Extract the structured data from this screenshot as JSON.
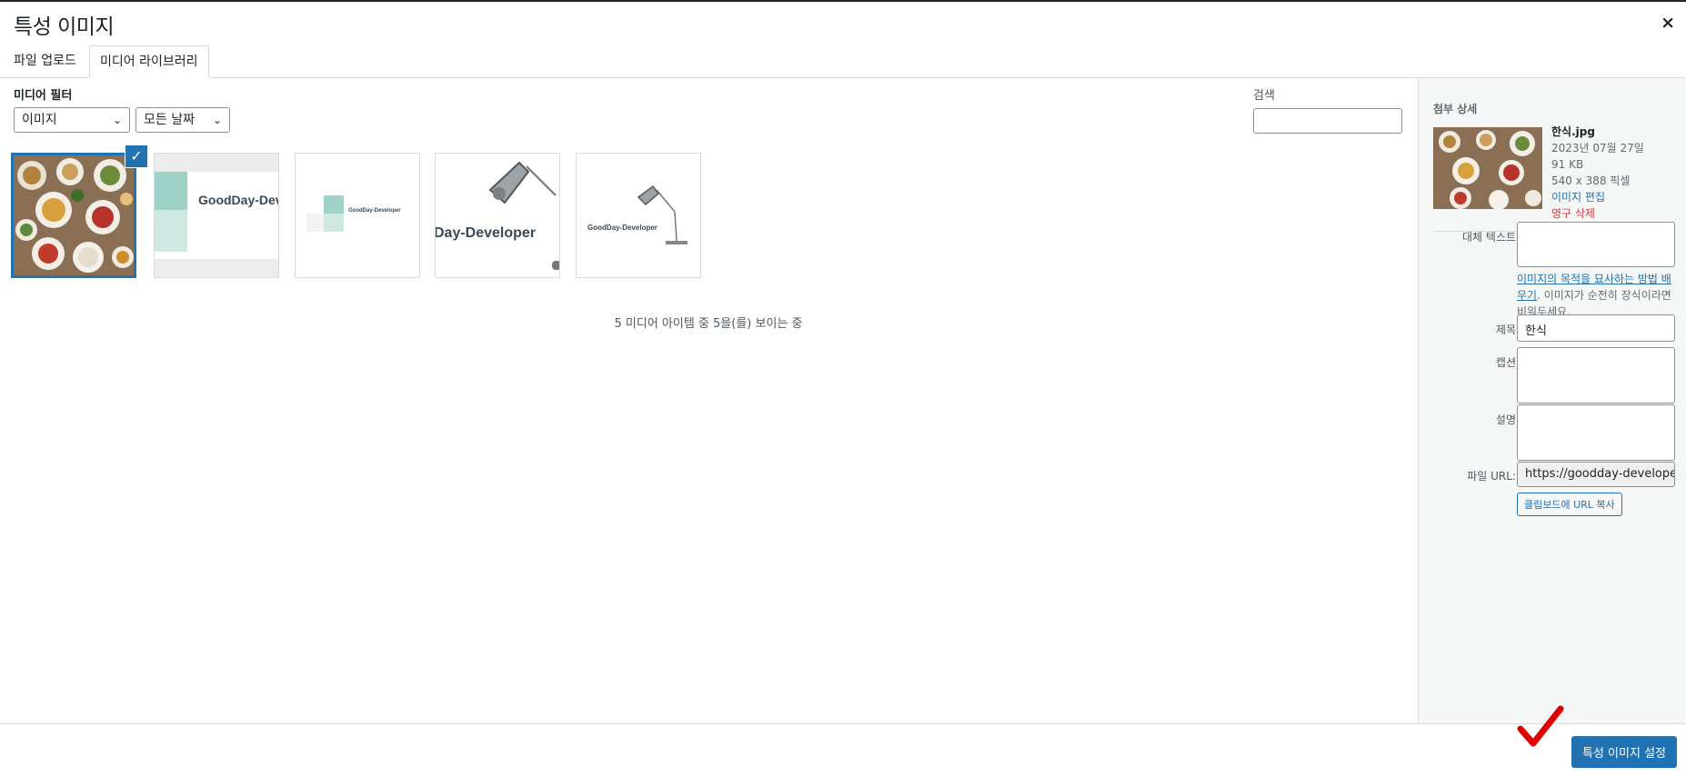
{
  "modal": {
    "title": "특성 이미지",
    "close_label": "×"
  },
  "tabs": [
    {
      "label": "파일 업로드"
    },
    {
      "label": "미디어 라이브러리"
    }
  ],
  "filters": {
    "label": "미디어 필터",
    "type_value": "이미지",
    "date_value": "모든 날짜"
  },
  "search": {
    "label": "검색",
    "value": ""
  },
  "media_items": [
    {
      "name": "한식.jpg",
      "selected": true
    },
    {
      "name": "GoodDay-Developer banner",
      "text": "GoodDay-Dev"
    },
    {
      "name": "GoodDay-Developer logo small",
      "text": "GoodDay-Developer"
    },
    {
      "name": "GoodDay-Developer lamp large",
      "text": "Day-Developer"
    },
    {
      "name": "GoodDay-Developer lamp small",
      "text": "GoodDay-Developer"
    }
  ],
  "count_text": "5 미디어 아이템 중 5을(를) 보이는 중",
  "attachment": {
    "heading": "첨부 상세",
    "filename": "한식.jpg",
    "date": "2023년 07월 27일",
    "size": "91 KB",
    "dimensions": "540 x 388 픽셀",
    "edit_link": "이미지 편집",
    "delete_link": "영구 삭제",
    "alt_label": "대체 텍스트",
    "alt_value": "",
    "help_link": "이미지의 목적을 묘사하는 방법 배우기",
    "help_rest": ". 이미지가 순전히 장식이라면 비워두세요.",
    "title_label": "제목",
    "title_value": "한식",
    "caption_label": "캡션",
    "caption_value": "",
    "desc_label": "설명",
    "desc_value": "",
    "url_label": "파일 URL:",
    "url_value": "https://goodday-developer",
    "copy_button": "클립보드에 URL 복사"
  },
  "footer": {
    "set_button": "특성 이미지 설정"
  },
  "colors": {
    "accent": "#2271b1",
    "danger": "#d63638",
    "annotation": "#e00000"
  }
}
